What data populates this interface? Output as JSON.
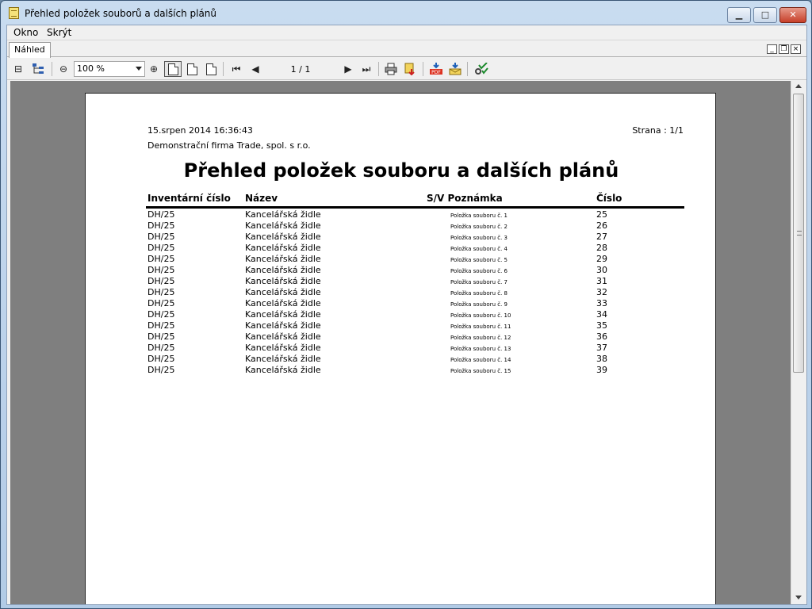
{
  "window": {
    "title": "Přehled položek souborů a dalších plánů"
  },
  "menu": {
    "items": [
      "Okno",
      "Skrýt"
    ]
  },
  "tabs": [
    "Náhled"
  ],
  "toolbar": {
    "zoom": "100 %",
    "page_indicator": "1 / 1"
  },
  "report": {
    "date": "15.srpen 2014 16:36:43",
    "page": "Strana : 1/1",
    "company": "Demonstrační firma Trade, spol. s r.o.",
    "title": "Přehled položek souboru a dalších plánů",
    "columns": [
      "Inventární číslo",
      "Název",
      "S/V Poznámka",
      "Číslo"
    ],
    "rows": [
      {
        "inv": "DH/25",
        "name": "Kancelářská židle",
        "note": "Položka souboru č. 1",
        "num": "25"
      },
      {
        "inv": "DH/25",
        "name": "Kancelářská židle",
        "note": "Položka souboru č. 2",
        "num": "26"
      },
      {
        "inv": "DH/25",
        "name": "Kancelářská židle",
        "note": "Položka souboru č. 3",
        "num": "27"
      },
      {
        "inv": "DH/25",
        "name": "Kancelářská židle",
        "note": "Položka souboru č. 4",
        "num": "28"
      },
      {
        "inv": "DH/25",
        "name": "Kancelářská židle",
        "note": "Položka souboru č. 5",
        "num": "29"
      },
      {
        "inv": "DH/25",
        "name": "Kancelářská židle",
        "note": "Položka souboru č. 6",
        "num": "30"
      },
      {
        "inv": "DH/25",
        "name": "Kancelářská židle",
        "note": "Položka souboru č. 7",
        "num": "31"
      },
      {
        "inv": "DH/25",
        "name": "Kancelářská židle",
        "note": "Položka souboru č. 8",
        "num": "32"
      },
      {
        "inv": "DH/25",
        "name": "Kancelářská židle",
        "note": "Položka souboru č. 9",
        "num": "33"
      },
      {
        "inv": "DH/25",
        "name": "Kancelářská židle",
        "note": "Položka souboru č. 10",
        "num": "34"
      },
      {
        "inv": "DH/25",
        "name": "Kancelářská židle",
        "note": "Položka souboru č. 11",
        "num": "35"
      },
      {
        "inv": "DH/25",
        "name": "Kancelářská židle",
        "note": "Položka souboru č. 12",
        "num": "36"
      },
      {
        "inv": "DH/25",
        "name": "Kancelářská židle",
        "note": "Položka souboru č. 13",
        "num": "37"
      },
      {
        "inv": "DH/25",
        "name": "Kancelářská židle",
        "note": "Položka souboru č. 14",
        "num": "38"
      },
      {
        "inv": "DH/25",
        "name": "Kancelářská židle",
        "note": "Položka souboru č. 15",
        "num": "39"
      }
    ]
  }
}
